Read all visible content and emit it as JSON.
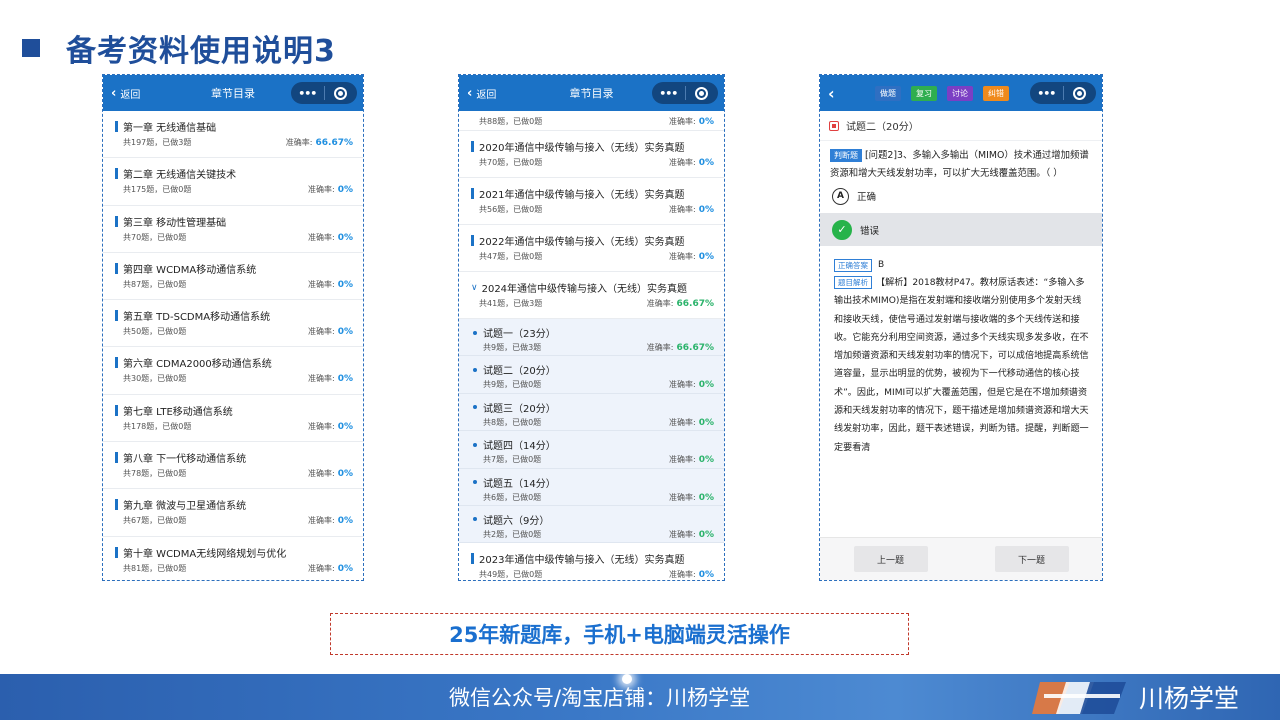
{
  "heading": "备考资料使用说明3",
  "phone1": {
    "back": "返回",
    "title": "章节目录",
    "rate_label": "准确率:",
    "chapters": [
      {
        "name": "第一章 无线通信基础",
        "meta": "共197题，已做3题",
        "rate": "66.67%"
      },
      {
        "name": "第二章 无线通信关键技术",
        "meta": "共175题，已做0题",
        "rate": "0%"
      },
      {
        "name": "第三章 移动性管理基础",
        "meta": "共70题，已做0题",
        "rate": "0%"
      },
      {
        "name": "第四章 WCDMA移动通信系统",
        "meta": "共87题，已做0题",
        "rate": "0%"
      },
      {
        "name": "第五章 TD-SCDMA移动通信系统",
        "meta": "共50题，已做0题",
        "rate": "0%"
      },
      {
        "name": "第六章 CDMA2000移动通信系统",
        "meta": "共30题，已做0题",
        "rate": "0%"
      },
      {
        "name": "第七章 LTE移动通信系统",
        "meta": "共178题，已做0题",
        "rate": "0%"
      },
      {
        "name": "第八章 下一代移动通信系统",
        "meta": "共78题，已做0题",
        "rate": "0%"
      },
      {
        "name": "第九章 微波与卫星通信系统",
        "meta": "共67题，已做0题",
        "rate": "0%"
      },
      {
        "name": "第十章 WCDMA无线网络规划与优化",
        "meta": "共81题，已做0题",
        "rate": "0%"
      }
    ]
  },
  "phone2": {
    "back": "返回",
    "title": "章节目录",
    "rate_label": "准确率:",
    "partial_top": {
      "meta": "共88题，已做0题",
      "rate": "0%"
    },
    "years": [
      {
        "name": "2020年通信中级传输与接入（无线）实务真题",
        "meta": "共70题，已做0题",
        "rate": "0%"
      },
      {
        "name": "2021年通信中级传输与接入（无线）实务真题",
        "meta": "共56题，已做0题",
        "rate": "0%"
      },
      {
        "name": "2022年通信中级传输与接入（无线）实务真题",
        "meta": "共47题，已做0题",
        "rate": "0%"
      }
    ],
    "expanded": {
      "name": "2024年通信中级传输与接入（无线）实务真题",
      "meta": "共41题，已做3题",
      "rate": "66.67%"
    },
    "subs": [
      {
        "name": "试题一（23分）",
        "meta": "共9题，已做3题",
        "rate": "66.67%"
      },
      {
        "name": "试题二（20分）",
        "meta": "共9题，已做0题",
        "rate": "0%"
      },
      {
        "name": "试题三（20分）",
        "meta": "共8题，已做0题",
        "rate": "0%"
      },
      {
        "name": "试题四（14分）",
        "meta": "共7题，已做0题",
        "rate": "0%"
      },
      {
        "name": "试题五（14分）",
        "meta": "共6题，已做0题",
        "rate": "0%"
      },
      {
        "name": "试题六（9分）",
        "meta": "共2题，已做0题",
        "rate": "0%"
      }
    ],
    "last": {
      "name": "2023年通信中级传输与接入（无线）实务真题",
      "meta": "共49题，已做0题",
      "rate": "0%"
    }
  },
  "phone3": {
    "tabs": [
      {
        "label": "做题",
        "color": "#2f6fc2"
      },
      {
        "label": "复习",
        "color": "#2fae4f"
      },
      {
        "label": "讨论",
        "color": "#7b3fc4"
      },
      {
        "label": "纠错",
        "color": "#f08a1c"
      }
    ],
    "section": "试题二（20分）",
    "type_tag": "判断题",
    "stem": "[问题2]3、多输入多输出（MIMO）技术通过增加频谱资源和增大天线发射功率，可以扩大无线覆盖范围。（   ）",
    "option_a_letter": "A",
    "option_a": "正确",
    "option_b": "错误",
    "answer_label": "正确答案",
    "answer": "B",
    "analysis_label": "题目解析",
    "analysis": "【解析】2018教材P47。教材原话表述：“多输入多输出技术MIMO)是指在发射端和接收端分别使用多个发射天线和接收天线，使信号通过发射端与接收端的多个天线传送和接收。它能充分利用空间资源，通过多个天线实现多发多收，在不增加频谱资源和天线发射功率的情况下，可以成倍地提高系统信道容量，显示出明显的优势，被视为下一代移动通信的核心技术”。因此，MIMI可以扩大覆盖范围，但是它是在不增加频谱资源和天线发射功率的情况下，题干描述是增加频谱资源和增大天线发射功率，因此，题干表述错误，判断为错。提醒，判断题一定要看清",
    "prev": "上一题",
    "next": "下一题"
  },
  "caption": "25年新题库，手机+电脑端灵活操作",
  "footer": {
    "text": "微信公众号/淘宝店铺：川杨学堂",
    "brand": "川杨学堂"
  }
}
